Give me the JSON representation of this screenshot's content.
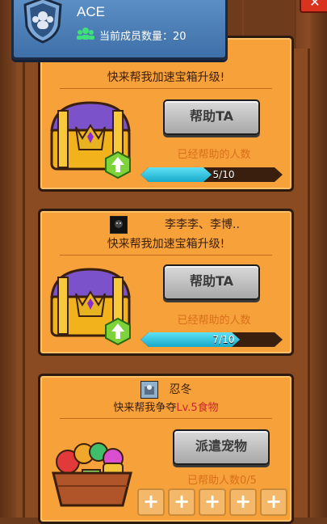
{
  "header": {
    "name": "ACE",
    "member_label": "当前成员数量：20",
    "close_icon": "close-icon"
  },
  "cards": [
    {
      "request": "快来帮我加速宝箱升级!",
      "button": "帮助TA",
      "helped_label": "已经帮助的人数",
      "progress": "5/10",
      "progress_value": 0.5
    },
    {
      "user": "李李李、李博..",
      "request": "快来帮我加速宝箱升级!",
      "button": "帮助TA",
      "helped_label": "已经帮助的人数",
      "progress": "7/10",
      "progress_value": 0.7
    },
    {
      "user": "忍冬",
      "request_prefix": "快来帮我争夺",
      "request_level": "Lv.5",
      "request_suffix": "食物",
      "button": "派遣宠物",
      "helped_label": "已帮助人数0/5",
      "slots": [
        "+",
        "+",
        "+",
        "+",
        "+"
      ]
    }
  ],
  "colors": {
    "card": "#f7a13a",
    "header": "#4a7db6",
    "progress": "#1fb6d4",
    "level": "#c92a2a"
  }
}
